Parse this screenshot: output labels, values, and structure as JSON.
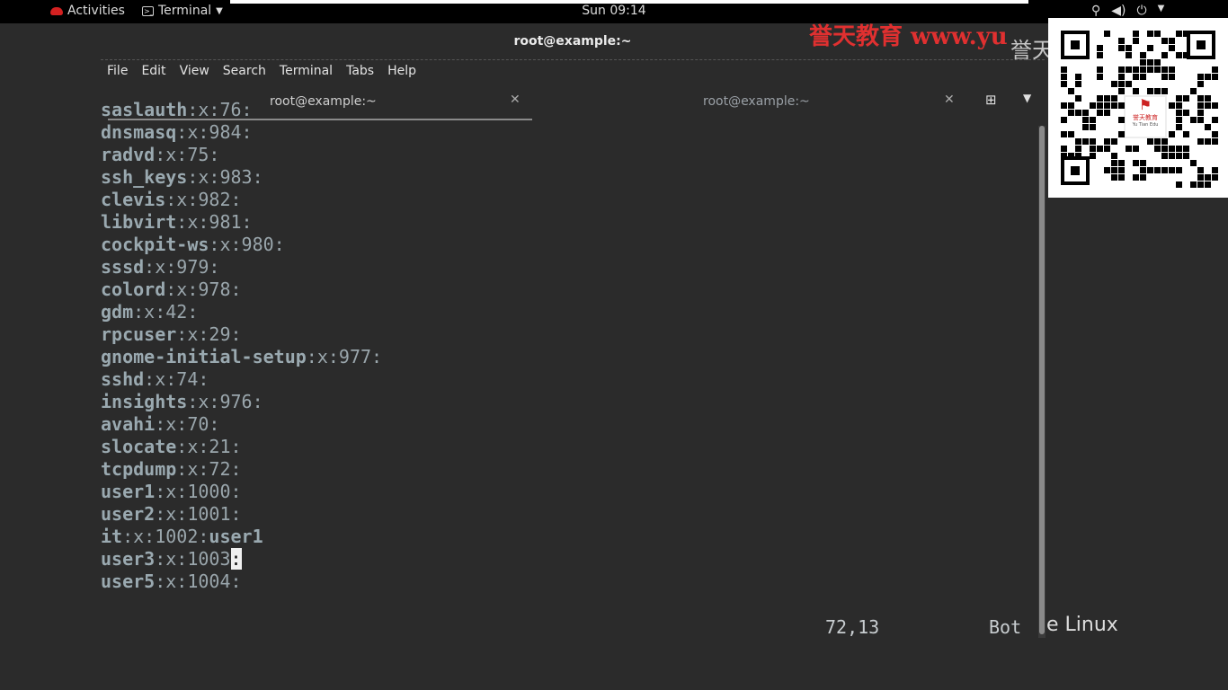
{
  "topbar": {
    "activities": "Activities",
    "app": "Terminal",
    "clock": "Sun 09:14",
    "status_icons": [
      "network-icon",
      "volume-icon",
      "power-icon",
      "chevron-down-icon"
    ]
  },
  "window": {
    "title": "root@example:~",
    "menu": [
      "File",
      "Edit",
      "View",
      "Search",
      "Terminal",
      "Tabs",
      "Help"
    ],
    "tabs": [
      {
        "label": "root@example:~",
        "active": true
      },
      {
        "label": "root@example:~",
        "active": false
      }
    ]
  },
  "terminal": {
    "lines": [
      {
        "user": "saslauth",
        "rest": ":x:76:"
      },
      {
        "user": "dnsmasq",
        "rest": ":x:984:"
      },
      {
        "user": "radvd",
        "rest": ":x:75:"
      },
      {
        "user": "ssh_keys",
        "rest": ":x:983:"
      },
      {
        "user": "clevis",
        "rest": ":x:982:"
      },
      {
        "user": "libvirt",
        "rest": ":x:981:"
      },
      {
        "user": "cockpit-ws",
        "rest": ":x:980:"
      },
      {
        "user": "sssd",
        "rest": ":x:979:"
      },
      {
        "user": "colord",
        "rest": ":x:978:"
      },
      {
        "user": "gdm",
        "rest": ":x:42:"
      },
      {
        "user": "rpcuser",
        "rest": ":x:29:"
      },
      {
        "user": "gnome-initial-setup",
        "rest": ":x:977:"
      },
      {
        "user": "sshd",
        "rest": ":x:74:"
      },
      {
        "user": "insights",
        "rest": ":x:976:"
      },
      {
        "user": "avahi",
        "rest": ":x:70:"
      },
      {
        "user": "slocate",
        "rest": ":x:21:"
      },
      {
        "user": "tcpdump",
        "rest": ":x:72:"
      },
      {
        "user": "user1",
        "rest": ":x:1000:"
      },
      {
        "user": "user2",
        "rest": ":x:1001:"
      },
      {
        "user": "it",
        "rest": ":x:1002:",
        "member": "user1"
      },
      {
        "user": "user3",
        "rest": ":x:1003",
        "cursor": ":"
      },
      {
        "user": "user5",
        "rest": ":x:1004:"
      }
    ],
    "position": "72,13",
    "scroll": "Bot"
  },
  "overlay": {
    "brand_text": "e Linux",
    "watermark_cn": "誉天教育 www.yu",
    "watermark_gray": "誉天",
    "qr_logo_text": "誉天教育",
    "qr_logo_sub": "Yu Tian Edu"
  }
}
